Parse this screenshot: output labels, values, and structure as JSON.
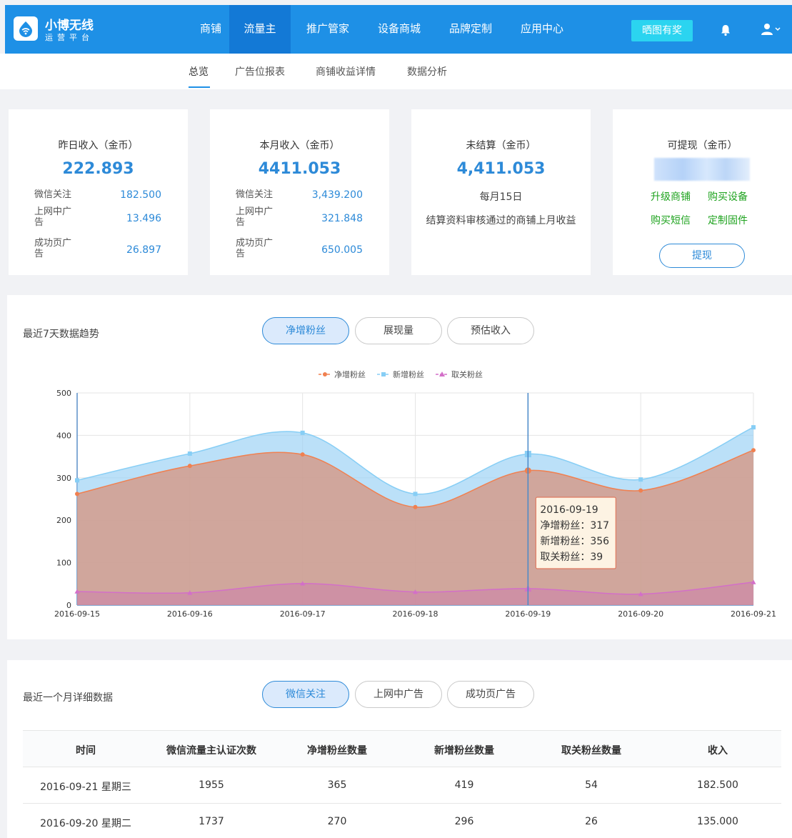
{
  "brand": {
    "title": "小博无线",
    "subtitle": "运营平台"
  },
  "nav": {
    "items": [
      {
        "label": "商铺",
        "active": false
      },
      {
        "label": "流量主",
        "active": true
      },
      {
        "label": "推广管家",
        "active": false
      },
      {
        "label": "设备商城",
        "active": false
      },
      {
        "label": "品牌定制",
        "active": false
      },
      {
        "label": "应用中心",
        "active": false
      }
    ],
    "promo_label": "晒图有奖",
    "bell_icon": "bell-icon",
    "user_icon": "user-icon"
  },
  "subnav": {
    "items": [
      "总览",
      "广告位报表",
      "商铺收益详情",
      "数据分析"
    ],
    "active": "总览"
  },
  "cards": {
    "yesterday": {
      "title": "昨日收入（金币）",
      "value": "222.893",
      "rows": [
        {
          "label": "微信关注",
          "value": "182.500"
        },
        {
          "label": "上网中广告",
          "value": "13.496"
        },
        {
          "label": "成功页广告",
          "value": "26.897"
        }
      ]
    },
    "month": {
      "title": "本月收入（金币）",
      "value": "4411.053",
      "rows": [
        {
          "label": "微信关注",
          "value": "3,439.200"
        },
        {
          "label": "上网中广告",
          "value": "321.848"
        },
        {
          "label": "成功页广告",
          "value": "650.005"
        }
      ]
    },
    "unsettled": {
      "title": "未结算（金币）",
      "value": "4,411.053",
      "date_text": "每月15日",
      "note": "结算资料审核通过的商铺上月收益"
    },
    "withdrawable": {
      "title": "可提现（金币）",
      "links": [
        "升级商铺",
        "购买设备",
        "购买短信",
        "定制固件"
      ],
      "button": "提现"
    }
  },
  "trend": {
    "title": "最近7天数据趋势",
    "tabs": [
      "净增粉丝",
      "展现量",
      "预估收入"
    ],
    "active_tab": "净增粉丝",
    "tooltip": {
      "date": "2016-09-19",
      "lines": [
        "净增粉丝：317",
        "新增粉丝：356",
        "取关粉丝：39"
      ]
    }
  },
  "chart_data": {
    "type": "area",
    "x": [
      "2016-09-15",
      "2016-09-16",
      "2016-09-17",
      "2016-09-18",
      "2016-09-19",
      "2016-09-20",
      "2016-09-21"
    ],
    "series": [
      {
        "name": "净增粉丝",
        "values": [
          262,
          328,
          355,
          231,
          317,
          270,
          365
        ],
        "color": "#f08050"
      },
      {
        "name": "新增粉丝",
        "values": [
          294,
          357,
          406,
          262,
          356,
          296,
          419
        ],
        "color": "#87cef5"
      },
      {
        "name": "取关粉丝",
        "values": [
          32,
          29,
          51,
          31,
          39,
          26,
          54
        ],
        "color": "#d36fc8"
      }
    ],
    "ylim": [
      0,
      500
    ],
    "yticks": [
      0,
      100,
      200,
      300,
      400,
      500
    ],
    "legend": "top-center",
    "grid": true,
    "highlight_index": 4
  },
  "detail": {
    "title": "最近一个月详细数据",
    "tabs": [
      "微信关注",
      "上网中广告",
      "成功页广告"
    ],
    "active_tab": "微信关注",
    "columns": [
      "时间",
      "微信流量主认证次数",
      "净增粉丝数量",
      "新增粉丝数量",
      "取关粉丝数量",
      "收入"
    ],
    "rows": [
      [
        "2016-09-21 星期三",
        "1955",
        "365",
        "419",
        "54",
        "182.500"
      ],
      [
        "2016-09-20 星期二",
        "1737",
        "270",
        "296",
        "26",
        "135.000"
      ]
    ]
  }
}
